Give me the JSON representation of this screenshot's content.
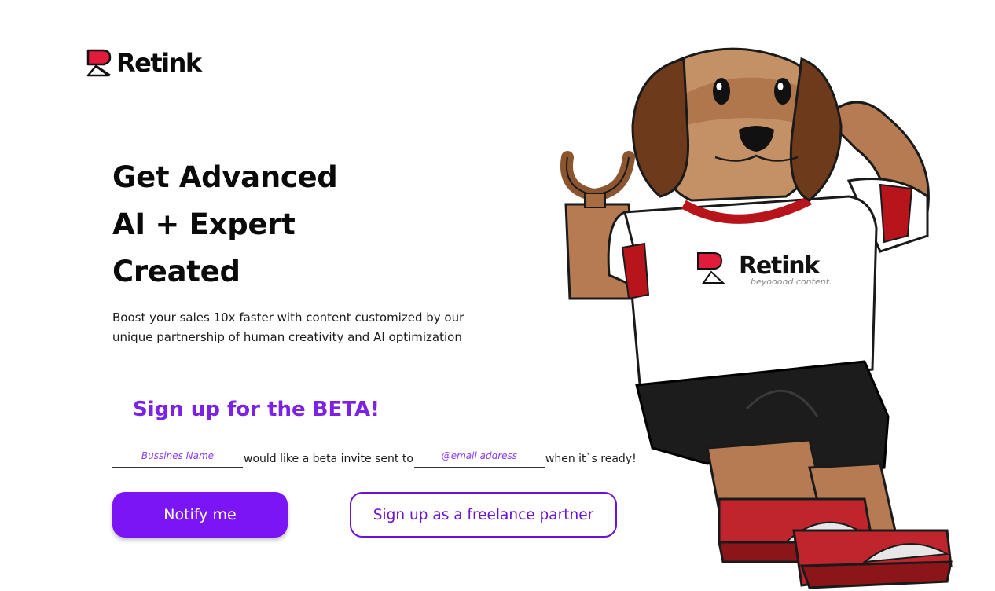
{
  "brand": {
    "name": "Retink",
    "accent": "#7b15f5",
    "logo_red": "#e01b3c"
  },
  "hero": {
    "headline": [
      "Get Advanced",
      "AI + Expert",
      "Created"
    ],
    "subtext": "Boost your sales 10x faster with content customized by our unique partnership of human creativity and AI optimization"
  },
  "beta": {
    "title": "Sign up for the BETA!",
    "business_placeholder": "Bussines Name",
    "business_value": "",
    "middle_text": "would like a beta invite sent to",
    "email_placeholder": "@email address",
    "email_value": "",
    "end_text": "when it`s ready!"
  },
  "buttons": {
    "notify": "Notify me",
    "partner": "Sign up as a freelance partner"
  },
  "mascot": {
    "shirt_brand": "Retink",
    "shirt_tagline": "beyooond content."
  }
}
